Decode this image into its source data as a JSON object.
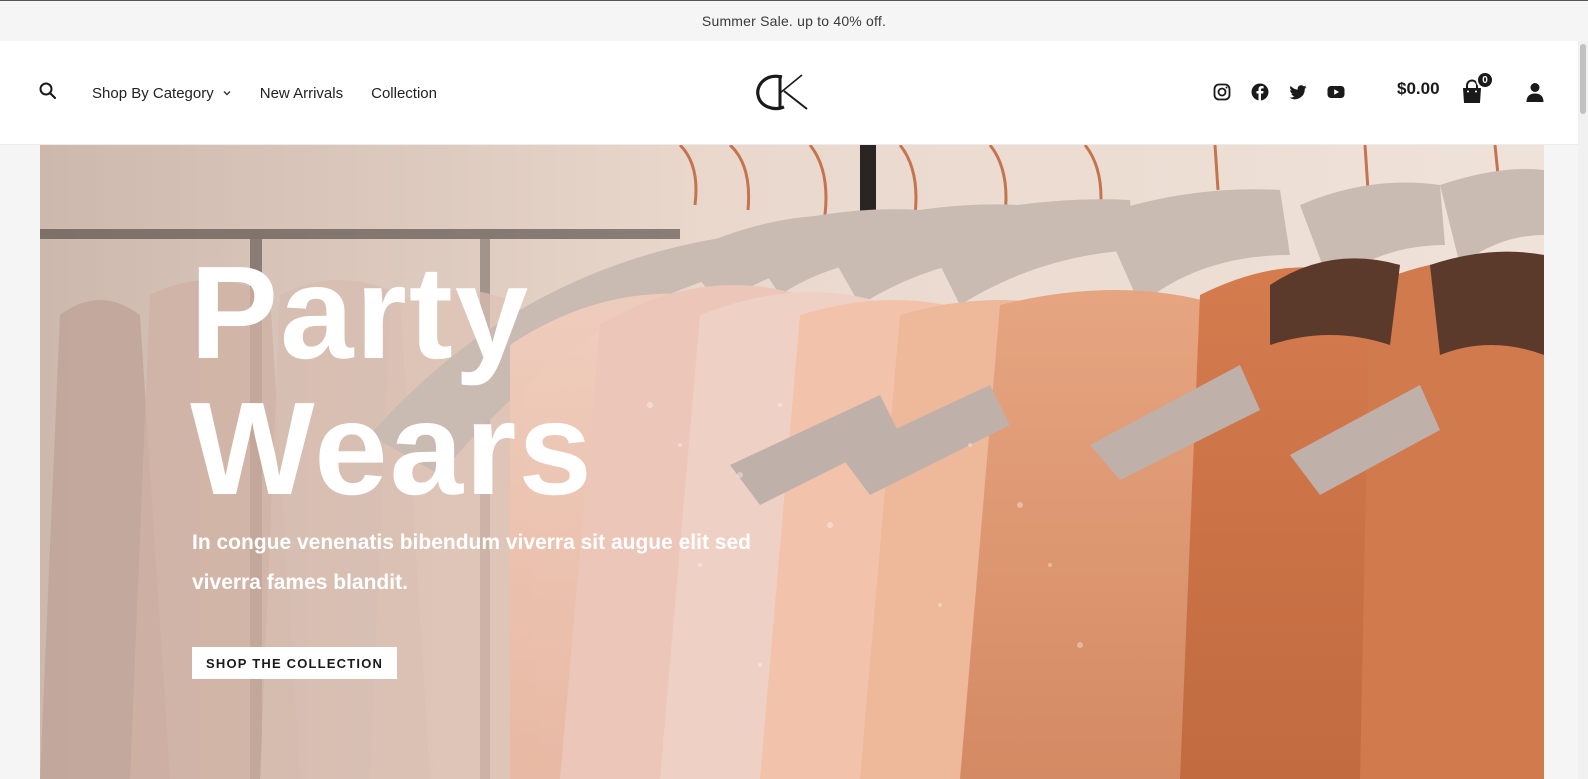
{
  "announcement": {
    "text": "Summer Sale. up to 40% off."
  },
  "header": {
    "search_icon": "search-icon",
    "nav": [
      {
        "label": "Shop By Category",
        "has_dropdown": true
      },
      {
        "label": "New Arrivals",
        "has_dropdown": false
      },
      {
        "label": "Collection",
        "has_dropdown": false
      }
    ],
    "logo_text": "CK",
    "socials": [
      "instagram-icon",
      "facebook-icon",
      "twitter-icon",
      "youtube-icon"
    ],
    "cart": {
      "total": "$0.00",
      "count": "0"
    },
    "account_icon": "user-icon"
  },
  "hero": {
    "title_line1": "Party",
    "title_line2": "Wears",
    "subtitle": "In congue venenatis bibendum viverra sit augue elit sed viverra fames blandit.",
    "cta": "SHOP THE COLLECTION"
  },
  "colors": {
    "announcement_bg": "#f5f5f5",
    "header_bg": "#ffffff",
    "text_dark": "#1f1f1f",
    "hero_peach": "#d89674"
  }
}
